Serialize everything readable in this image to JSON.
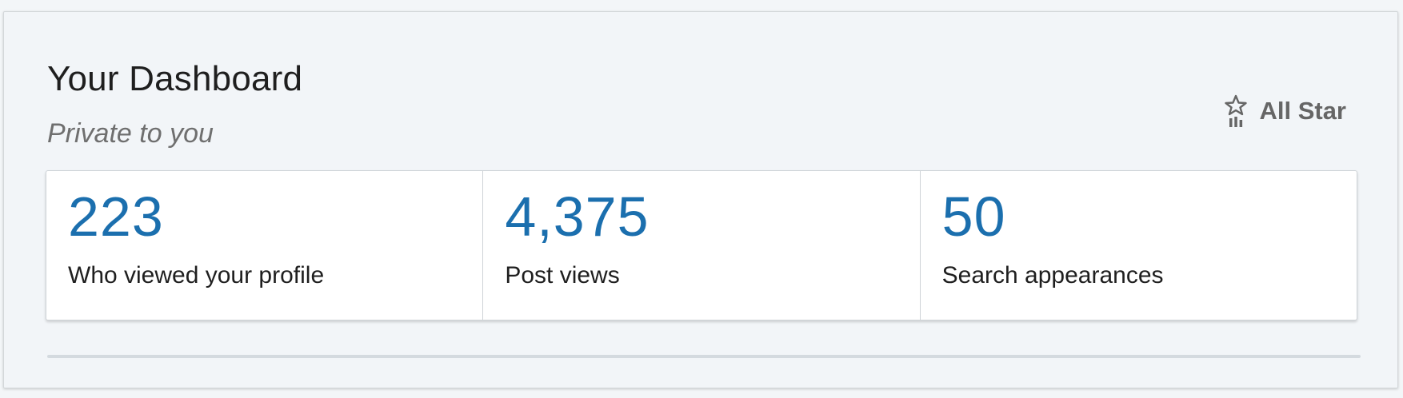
{
  "header": {
    "title": "Your Dashboard",
    "subtitle": "Private to you"
  },
  "badge": {
    "label": "All Star",
    "icon": "all-star-icon"
  },
  "stats": [
    {
      "value": "223",
      "label": "Who viewed your profile"
    },
    {
      "value": "4,375",
      "label": "Post views"
    },
    {
      "value": "50",
      "label": "Search appearances"
    }
  ],
  "colors": {
    "accent": "#1b6fae",
    "background": "#f2f5f8",
    "text": "#1f1f1f",
    "muted": "#6f6f6f"
  }
}
